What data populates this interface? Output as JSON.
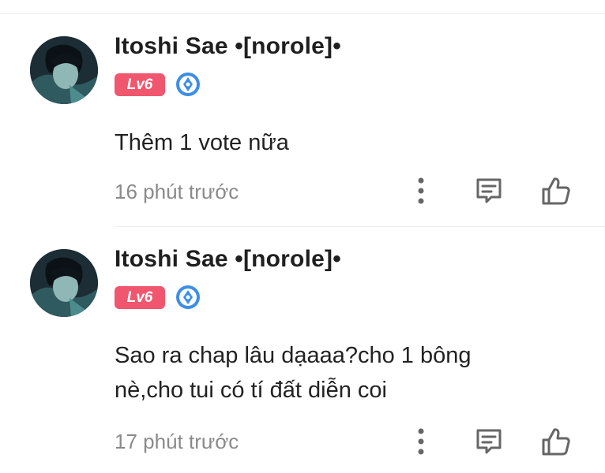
{
  "colors": {
    "level_badge_bg": "#f0566d",
    "medal_blue": "#3d8ee6",
    "timestamp": "#8a8a8a",
    "icon_gray": "#666666"
  },
  "comments": [
    {
      "username": "Itoshi Sae •[norole]•",
      "level": "Lv6",
      "medal_icon": "medal-badge-icon",
      "text": "Thêm 1 vote nữa",
      "time": "16 phút trước",
      "actions": [
        "more-options-icon",
        "reply-comment-icon",
        "like-thumb-icon"
      ]
    },
    {
      "username": "Itoshi Sae •[norole]•",
      "level": "Lv6",
      "medal_icon": "medal-badge-icon",
      "text": "Sao ra chap lâu dạaaa?cho 1 bông nè,cho tui có tí đất diễn coi",
      "time": "17 phút trước",
      "actions": [
        "more-options-icon",
        "reply-comment-icon",
        "like-thumb-icon"
      ]
    }
  ]
}
